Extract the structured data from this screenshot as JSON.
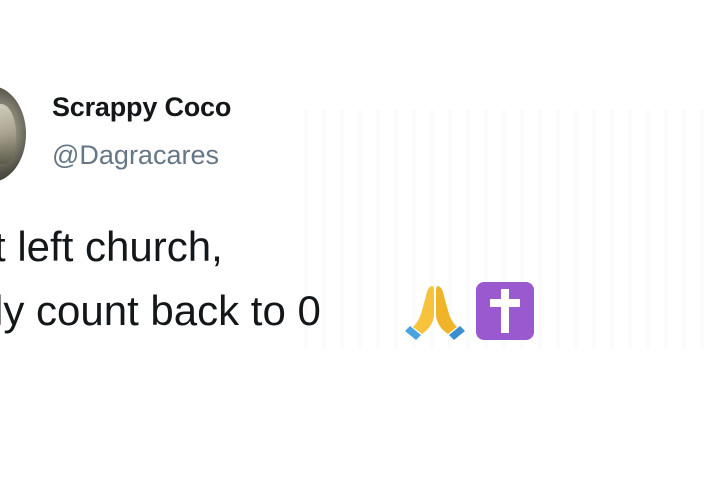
{
  "tweet": {
    "author_name": "Scrappy Coco",
    "author_handle": "@Dagracares",
    "text_line1": "t left church,",
    "text_line2": "ly count back to 0",
    "emojis": [
      "folded-hands-icon",
      "latin-cross-icon"
    ]
  },
  "colors": {
    "name_text": "#14171a",
    "handle_text": "#657786",
    "cross_box": "#9b59d0",
    "pray_hands": "#f7c23c",
    "pray_sleeve": "#4aa3df"
  }
}
